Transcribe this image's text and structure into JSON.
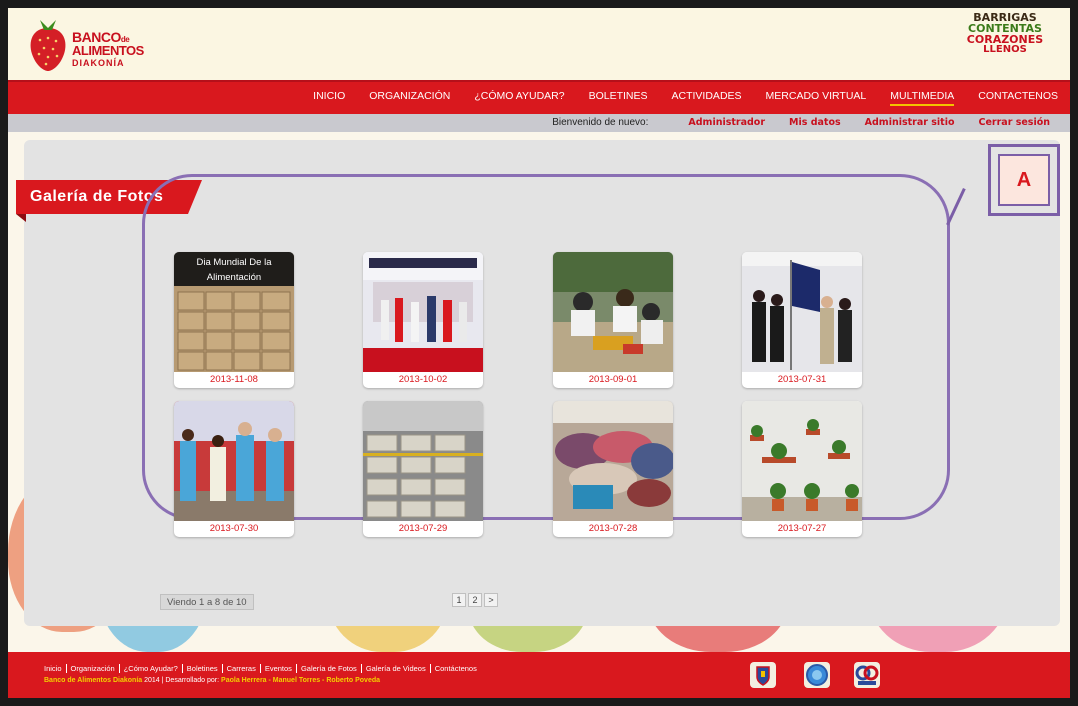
{
  "header": {
    "logo_left": {
      "line1": "BANCO",
      "line1_small": "de",
      "line2": "ALIMENTOS",
      "line3": "DIAKONÍA"
    },
    "logo_right": {
      "line1": "BARRIGAS",
      "line2": "CONTENTAS",
      "line3": "CORAZONES",
      "line4": "LLENOS"
    }
  },
  "nav": {
    "items": [
      {
        "label": "INICIO"
      },
      {
        "label": "ORGANIZACIÓN"
      },
      {
        "label": "¿CÓMO AYUDAR?"
      },
      {
        "label": "BOLETINES"
      },
      {
        "label": "ACTIVIDADES"
      },
      {
        "label": "MERCADO VIRTUAL"
      },
      {
        "label": "MULTIMEDIA"
      },
      {
        "label": "CONTACTENOS"
      }
    ],
    "active": "MULTIMEDIA"
  },
  "subbar": {
    "welcome": "Bienvenido de nuevo:",
    "links": [
      "Administrador",
      "Mis datos",
      "Administrar sitio",
      "Cerrar sesión"
    ]
  },
  "gallery": {
    "title": "Galería de Fotos",
    "annotation_label": "A",
    "photos": [
      {
        "date": "2013-11-08",
        "caption": "Dia Mundial De la Alimentación",
        "scene": "boxes"
      },
      {
        "date": "2013-10-02",
        "caption": "",
        "scene": "event"
      },
      {
        "date": "2013-09-01",
        "caption": "",
        "scene": "sorting"
      },
      {
        "date": "2013-07-31",
        "caption": "",
        "scene": "flag"
      },
      {
        "date": "2013-07-30",
        "caption": "",
        "scene": "group"
      },
      {
        "date": "2013-07-29",
        "caption": "",
        "scene": "warehouse"
      },
      {
        "date": "2013-07-28",
        "caption": "",
        "scene": "clothes"
      },
      {
        "date": "2013-07-27",
        "caption": "",
        "scene": "plants"
      }
    ],
    "pager": {
      "info": "Viendo 1 a 8 de 10",
      "pages": [
        "1",
        "2",
        ">"
      ]
    }
  },
  "footer": {
    "links": [
      "Inicio",
      "Organización",
      "¿Cómo Ayudar?",
      "Boletines",
      "Carreras",
      "Eventos",
      "Galería de Fotos",
      "Galería de Videos",
      "Contáctenos"
    ],
    "credit_name": "Banco de Alimentos Diakonía",
    "credit_year": " 2014 | Desarrollado por: ",
    "credit_authors": "Paola Herrera - Manuel Torres - Roberto Poveda"
  },
  "colors": {
    "brand_red": "#d9181e",
    "accent_yellow": "#f3c300",
    "annotation_purple": "#7b5ea7"
  }
}
